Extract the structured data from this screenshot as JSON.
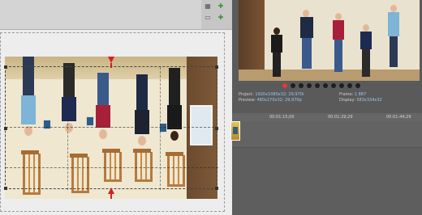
{
  "toolbar": {
    "icons": [
      "grid-icon",
      "lock-icon",
      "move-icon",
      "snap-icon"
    ]
  },
  "preview": {
    "project_label": "Project:",
    "project_value": "1920x1080x32; 29,970i",
    "preview_label": "Preview:",
    "preview_value": "480x270x32; 29,970p",
    "frame_label": "Frame:",
    "frame_value": "1 887",
    "display_label": "Display:",
    "display_value": "583x334x32"
  },
  "timeline": {
    "ticks": [
      "00:01:15;00",
      "00:01:29;29",
      "00:01:44;29"
    ]
  },
  "colors": {
    "accent": "#9ec7ee",
    "record": "#e03a3a",
    "crop_arrow": "#d42020"
  }
}
